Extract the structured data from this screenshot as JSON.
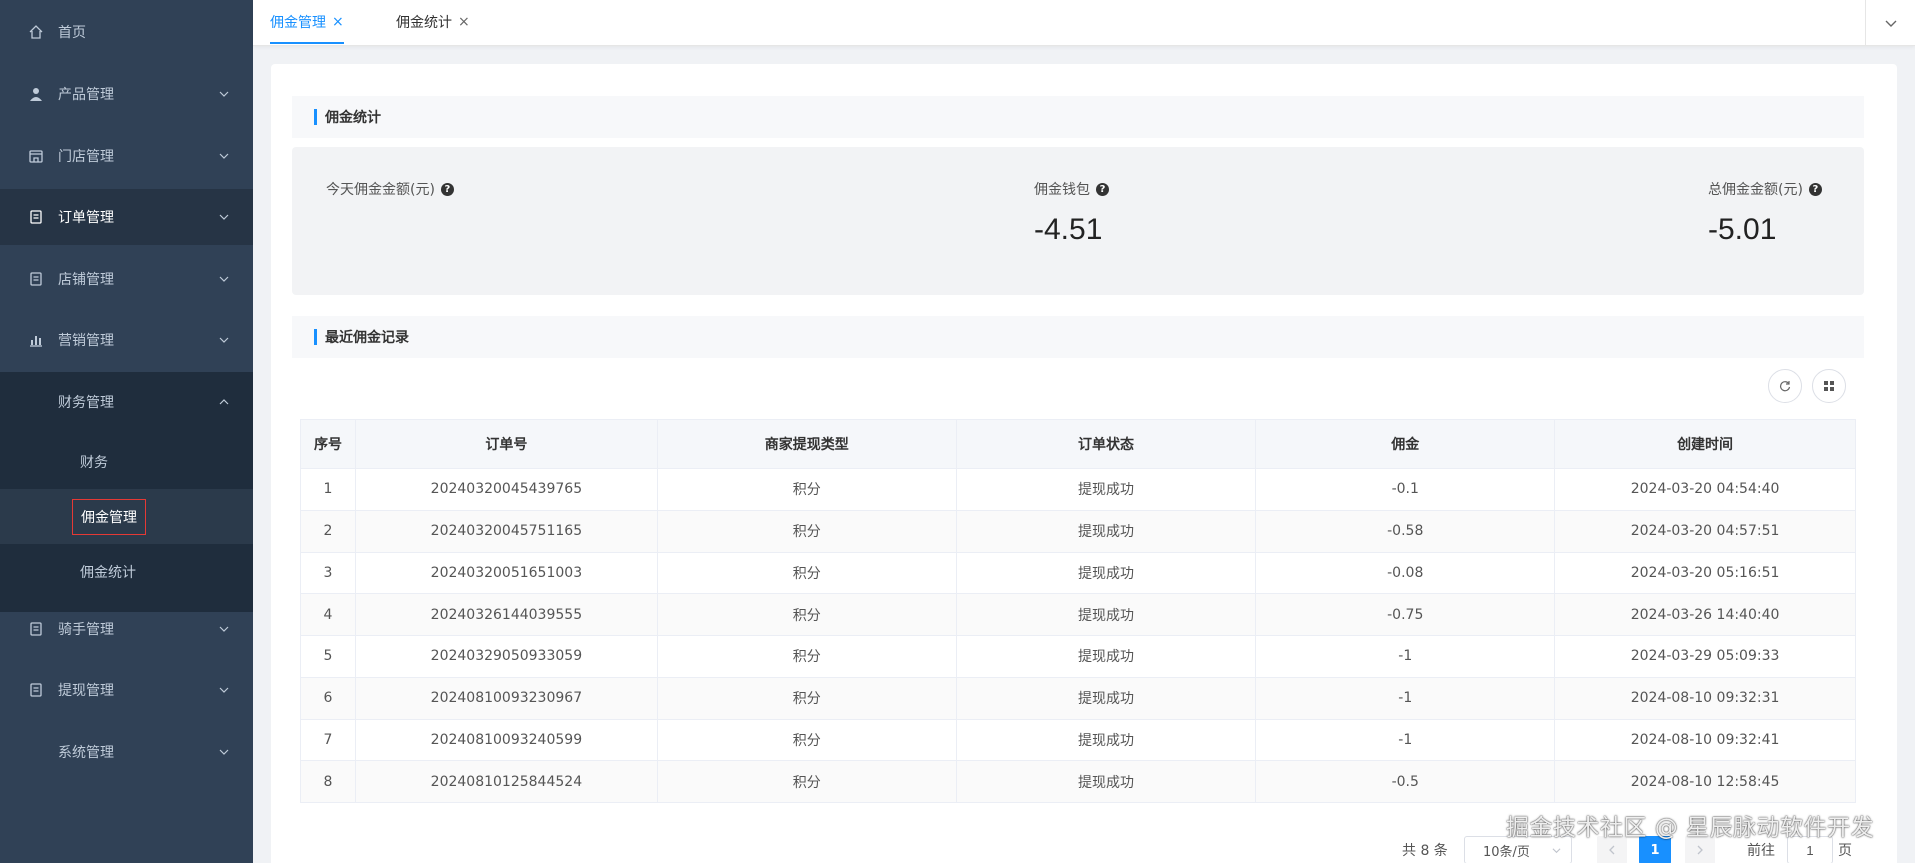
{
  "sidebar": {
    "items": [
      {
        "label": "首页",
        "icon": "home-icon"
      },
      {
        "label": "产品管理",
        "icon": "user-icon"
      },
      {
        "label": "门店管理",
        "icon": "store-icon"
      },
      {
        "label": "订单管理",
        "icon": "order-icon"
      },
      {
        "label": "店铺管理",
        "icon": "shop-doc-icon"
      },
      {
        "label": "营销管理",
        "icon": "bar-chart-icon"
      },
      {
        "label": "财务管理",
        "icon": ""
      },
      {
        "label": "骑手管理",
        "icon": "rider-icon"
      },
      {
        "label": "提现管理",
        "icon": "withdraw-icon"
      },
      {
        "label": "系统管理",
        "icon": ""
      }
    ],
    "finance_sub": [
      {
        "label": "财务"
      },
      {
        "label": "佣金管理"
      },
      {
        "label": "佣金统计"
      }
    ]
  },
  "tabs": [
    {
      "label": "佣金管理",
      "close": "×"
    },
    {
      "label": "佣金统计",
      "close": "×"
    }
  ],
  "section_stats": {
    "title": "佣金统计"
  },
  "stats": [
    {
      "label": "今天佣金金额(元)",
      "value": ""
    },
    {
      "label": "佣金钱包",
      "value": "-4.51"
    },
    {
      "label": "总佣金金额(元)",
      "value": "-5.01"
    }
  ],
  "section_records": {
    "title": "最近佣金记录"
  },
  "table": {
    "headers": [
      "序号",
      "订单号",
      "商家提现类型",
      "订单状态",
      "佣金",
      "创建时间"
    ],
    "rows": [
      [
        "1",
        "20240320045439765",
        "积分",
        "提现成功",
        "-0.1",
        "2024-03-20 04:54:40"
      ],
      [
        "2",
        "20240320045751165",
        "积分",
        "提现成功",
        "-0.58",
        "2024-03-20 04:57:51"
      ],
      [
        "3",
        "20240320051651003",
        "积分",
        "提现成功",
        "-0.08",
        "2024-03-20 05:16:51"
      ],
      [
        "4",
        "20240326144039555",
        "积分",
        "提现成功",
        "-0.75",
        "2024-03-26 14:40:40"
      ],
      [
        "5",
        "20240329050933059",
        "积分",
        "提现成功",
        "-1",
        "2024-03-29 05:09:33"
      ],
      [
        "6",
        "20240810093230967",
        "积分",
        "提现成功",
        "-1",
        "2024-08-10 09:32:31"
      ],
      [
        "7",
        "20240810093240599",
        "积分",
        "提现成功",
        "-1",
        "2024-08-10 09:32:41"
      ],
      [
        "8",
        "20240810125844524",
        "积分",
        "提现成功",
        "-0.5",
        "2024-08-10 12:58:45"
      ]
    ]
  },
  "pagination": {
    "total_text": "共 8 条",
    "page_size": "10条/页",
    "current_page": "1",
    "goto_prefix": "前往",
    "goto_value": "1",
    "goto_suffix": "页"
  },
  "watermark": "掘金技术社区 @ 星辰脉动软件开发",
  "colors": {
    "sidebar_bg": "#304156",
    "accent": "#1890ff",
    "highlight_border": "#e53935"
  }
}
